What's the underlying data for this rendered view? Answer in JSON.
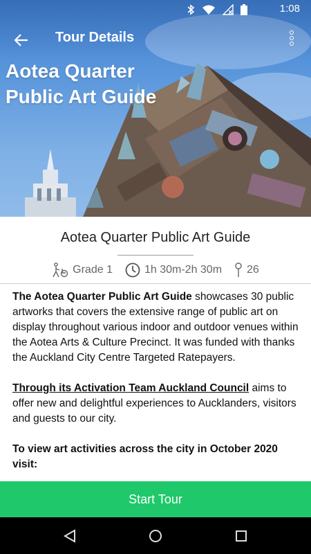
{
  "status_bar": {
    "time": "1:08",
    "icons": [
      "bluetooth-icon",
      "wifi-icon",
      "no-signal-icon",
      "battery-icon"
    ]
  },
  "app_bar": {
    "title": "Tour Details",
    "back_icon": "arrow-back-icon",
    "menu_icon": "more-vert-icon"
  },
  "hero": {
    "title_line1": "Aotea Quarter",
    "title_line2": "Public Art Guide"
  },
  "tour": {
    "title": "Aotea Quarter Public Art Guide",
    "grade": "Grade 1",
    "duration": "1h 30m-2h 30m",
    "stops": "26"
  },
  "description": {
    "p1_bold": "The Aotea Quarter Public Art Guide",
    "p1_rest": " showcases 30 public artworks that covers the extensive range of public art on display throughout various indoor and outdoor venues within the Aotea Arts & Culture Precinct. It was funded with thanks the Auckland City Centre Targeted Ratepayers.",
    "p2_link": "Through its Activation Team Auckland Council",
    "p2_rest": " aims to offer new and delightful experiences to Aucklanders, visitors and guests to our city.",
    "p3_bold": "To view art activities across the city in October 2020 visit:"
  },
  "actions": {
    "start_tour": "Start Tour"
  },
  "nav_bar": {
    "icons": [
      "back-triangle-icon",
      "home-circle-icon",
      "recents-square-icon"
    ]
  },
  "colors": {
    "accent_green": "#1fc86a",
    "sky_blue": "#5b97dc"
  }
}
